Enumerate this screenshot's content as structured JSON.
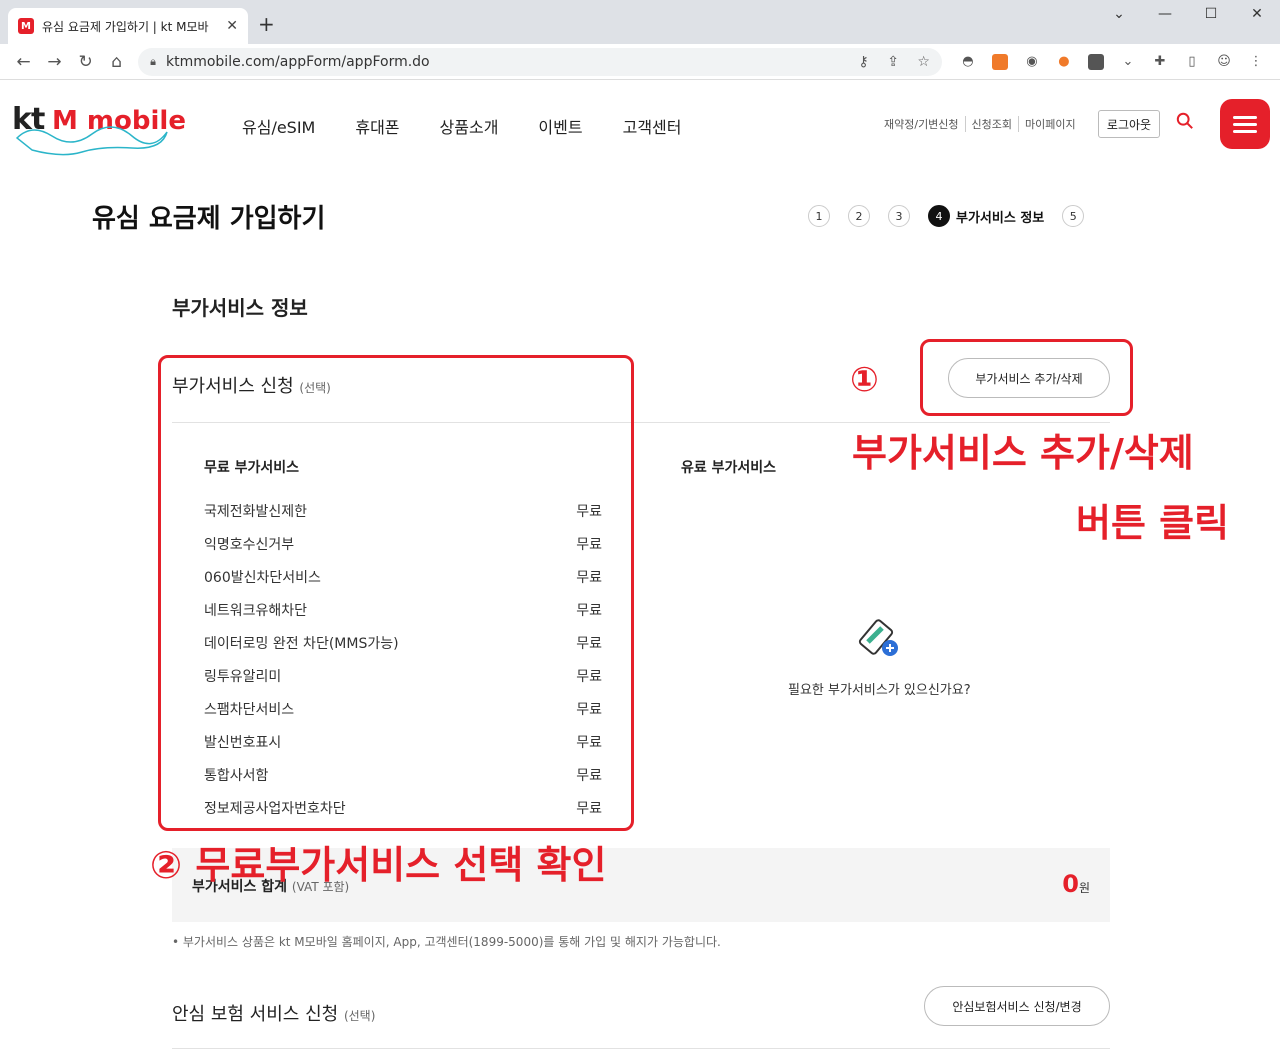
{
  "browser": {
    "tab_title": "유심 요금제 가입하기 | kt M모바",
    "favicon_text": "M",
    "url": "ktmmobile.com/appForm/appForm.do"
  },
  "header": {
    "logo_kt": "kt",
    "logo_m": "M mobile",
    "gnb": [
      "유심/eSIM",
      "휴대폰",
      "상품소개",
      "이벤트",
      "고객센터"
    ],
    "util": [
      "재약정/기변신청",
      "신청조회",
      "마이페이지"
    ],
    "logout": "로그아웃"
  },
  "page_title": "유심 요금제 가입하기",
  "steps": {
    "items": [
      "1",
      "2",
      "3",
      "4",
      "5"
    ],
    "active_label": "부가서비스 정보"
  },
  "section_title": "부가서비스 정보",
  "addon": {
    "title": "부가서비스 신청",
    "optional": "(선택)",
    "add_button": "부가서비스 추가/삭제",
    "free_head": "무료 부가서비스",
    "paid_head": "유료 부가서비스",
    "free_items": [
      {
        "name": "국제전화발신제한",
        "price": "무료"
      },
      {
        "name": "익명호수신거부",
        "price": "무료"
      },
      {
        "name": "060발신차단서비스",
        "price": "무료"
      },
      {
        "name": "네트워크유해차단",
        "price": "무료"
      },
      {
        "name": "데이터로밍 완전 차단(MMS가능)",
        "price": "무료"
      },
      {
        "name": "링투유알리미",
        "price": "무료"
      },
      {
        "name": "스팸차단서비스",
        "price": "무료"
      },
      {
        "name": "발신번호표시",
        "price": "무료"
      },
      {
        "name": "통합사서함",
        "price": "무료"
      },
      {
        "name": "정보제공사업자번호차단",
        "price": "무료"
      }
    ],
    "empty_text": "필요한 부가서비스가 있으신가요?"
  },
  "summary": {
    "label": "부가서비스 합계",
    "vat": "(VAT 포함)",
    "value": "0",
    "unit": "원"
  },
  "note": "• 부가서비스 상품은 kt M모바일 홈페이지, App, 고객센터(1899-5000)를 통해 가입 및 해지가 가능합니다.",
  "insurance": {
    "title": "안심 보험 서비스 신청",
    "optional": "(선택)",
    "button": "안심보험서비스 신청/변경"
  },
  "annotations": {
    "num1": "①",
    "text1_line1": "부가서비스 추가/삭제",
    "text1_line2": "버튼 클릭",
    "text2": "② 무료부가서비스 선택 확인"
  },
  "colors": {
    "accent": "#e5202a"
  }
}
